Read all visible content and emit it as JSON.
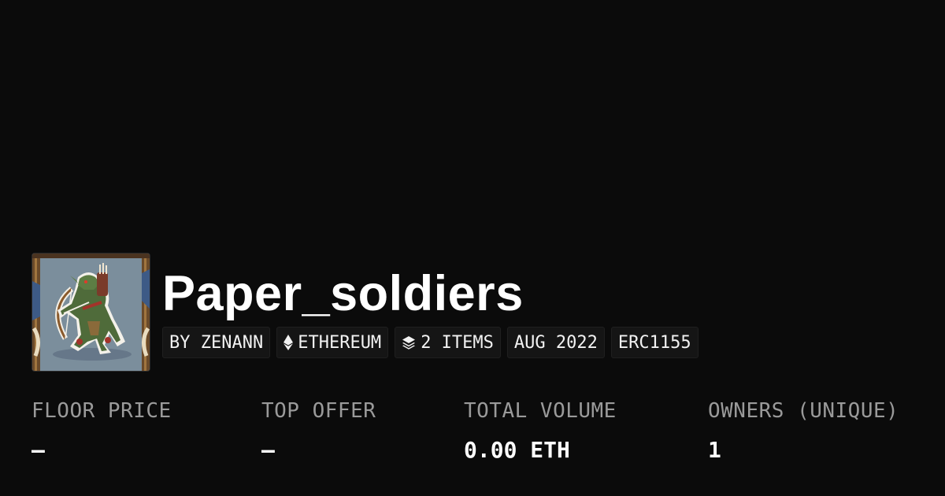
{
  "collection": {
    "name": "Paper_soldiers",
    "avatar_icon": "goblin-archer-image"
  },
  "tags": {
    "creator": "BY ZENANN",
    "chain": "ETHEREUM",
    "chain_icon": "ethereum-icon",
    "items": "2 ITEMS",
    "items_icon": "layers-icon",
    "date": "AUG 2022",
    "standard": "ERC1155"
  },
  "stats": {
    "floor_price": {
      "label": "FLOOR PRICE",
      "value": "—"
    },
    "top_offer": {
      "label": "TOP OFFER",
      "value": "—"
    },
    "total_volume": {
      "label": "TOTAL VOLUME",
      "value": "0.00 ETH"
    },
    "owners": {
      "label": "OWNERS (UNIQUE)",
      "value": "1"
    }
  },
  "colors": {
    "background": "#0b0b0b",
    "label": "#9a9a9a",
    "value": "#ffffff",
    "tag_bg": "#151515"
  }
}
